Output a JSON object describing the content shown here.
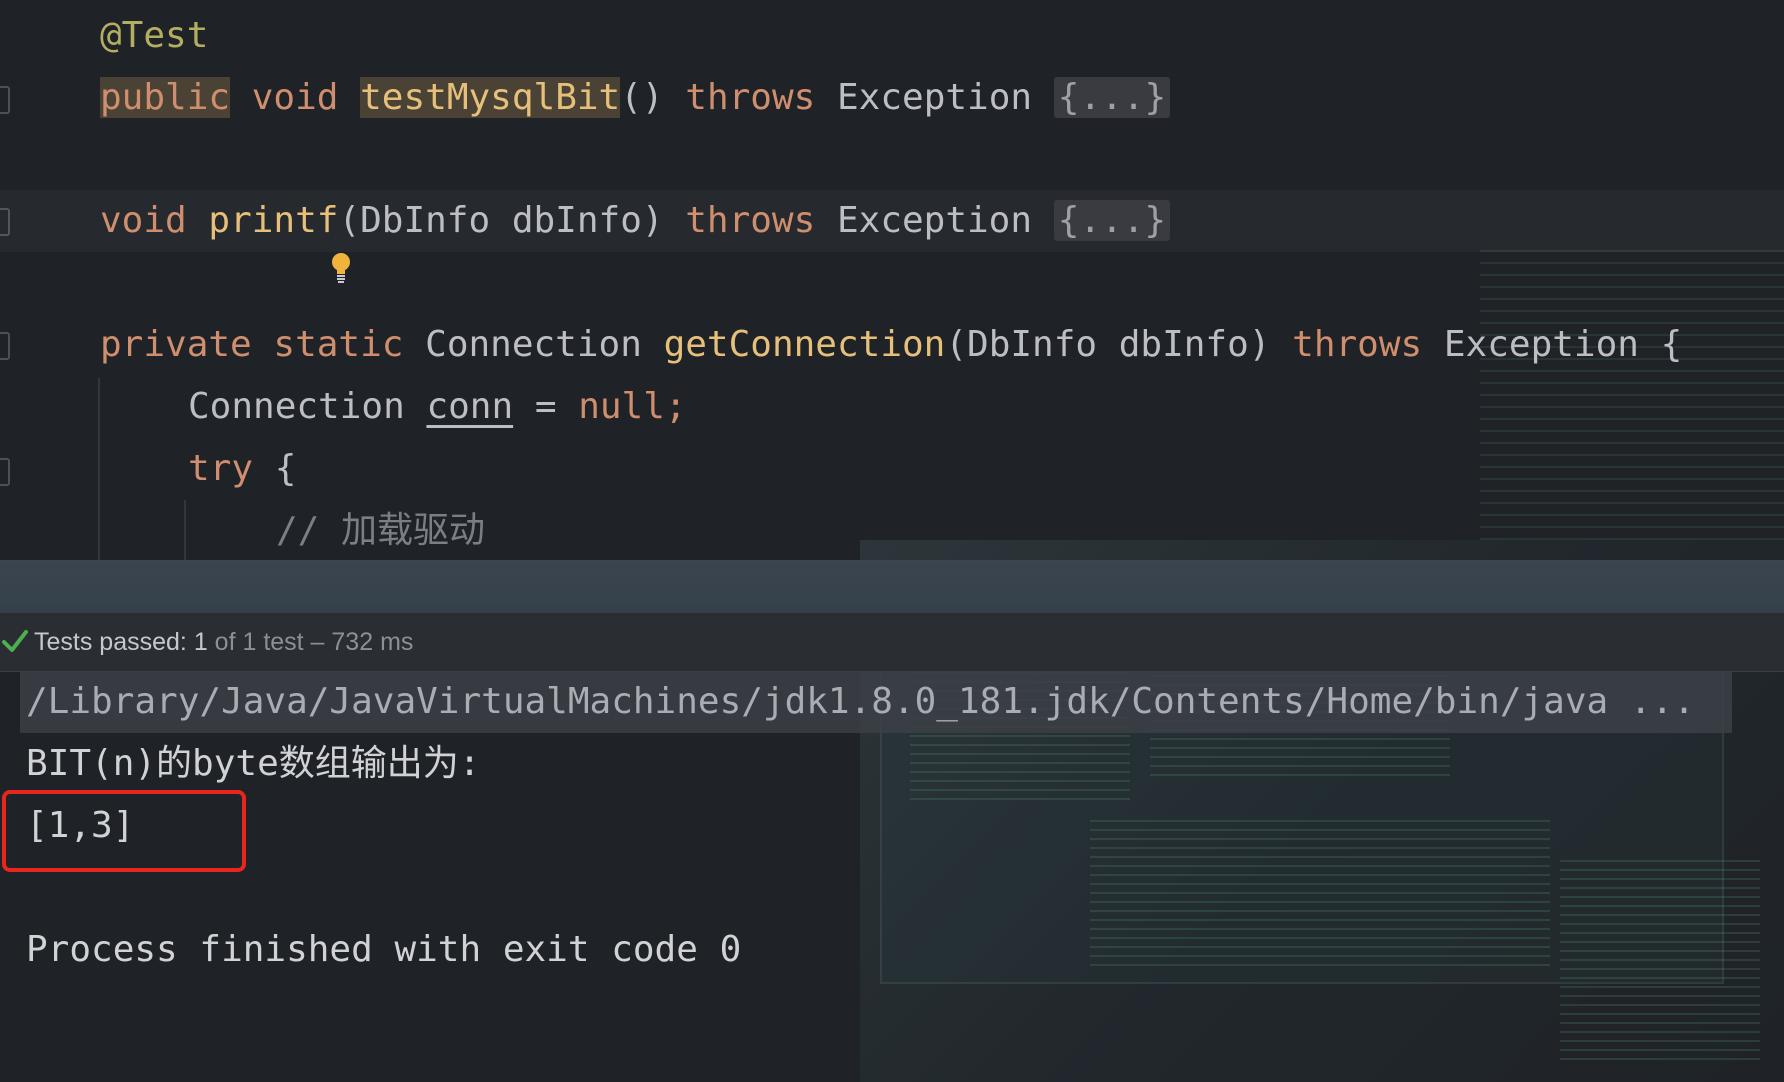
{
  "editor": {
    "lines": [
      {
        "annotation": "@Test"
      },
      {
        "modifier": "public",
        "type": "void",
        "name": "testMysqlBit",
        "params": "()",
        "throws": "throws",
        "exception": "Exception",
        "body": "{...}"
      },
      {
        "type": "void",
        "name": "printf",
        "params": "(DbInfo dbInfo)",
        "throws": "throws",
        "exception": "Exception",
        "body": "{...}"
      },
      {
        "modifier": "private",
        "modifier2": "static",
        "return_type": "Connection",
        "name": "getConnection",
        "params": "(DbInfo dbInfo)",
        "throws": "throws",
        "exception": "Exception",
        "open": "{"
      },
      {
        "type": "Connection",
        "var": "conn",
        "eq": "=",
        "value": "null;"
      },
      {
        "keyword": "try",
        "open": "{"
      },
      {
        "comment": "// 加载驱动"
      }
    ],
    "colors": {
      "keyword": "#cf8e6d",
      "annotation": "#b3ae60",
      "method": "#e6c07b",
      "comment": "#7a7e85",
      "plain": "#bcbec4"
    },
    "icons": [
      "lightbulb-icon"
    ]
  },
  "test_status": {
    "icon": "checkmark-icon",
    "label": "Tests passed:",
    "count": "1",
    "detail": "of 1 test – 732 ms",
    "color": "#4caf50"
  },
  "console": {
    "command": "/Library/Java/JavaVirtualMachines/jdk1.8.0_181.jdk/Contents/Home/bin/java ...",
    "output_label": "BIT(n)的byte数组输出为:",
    "output_value": "[1,3]",
    "finish": "Process finished with exit code 0",
    "highlight_color": "#e8261d"
  }
}
